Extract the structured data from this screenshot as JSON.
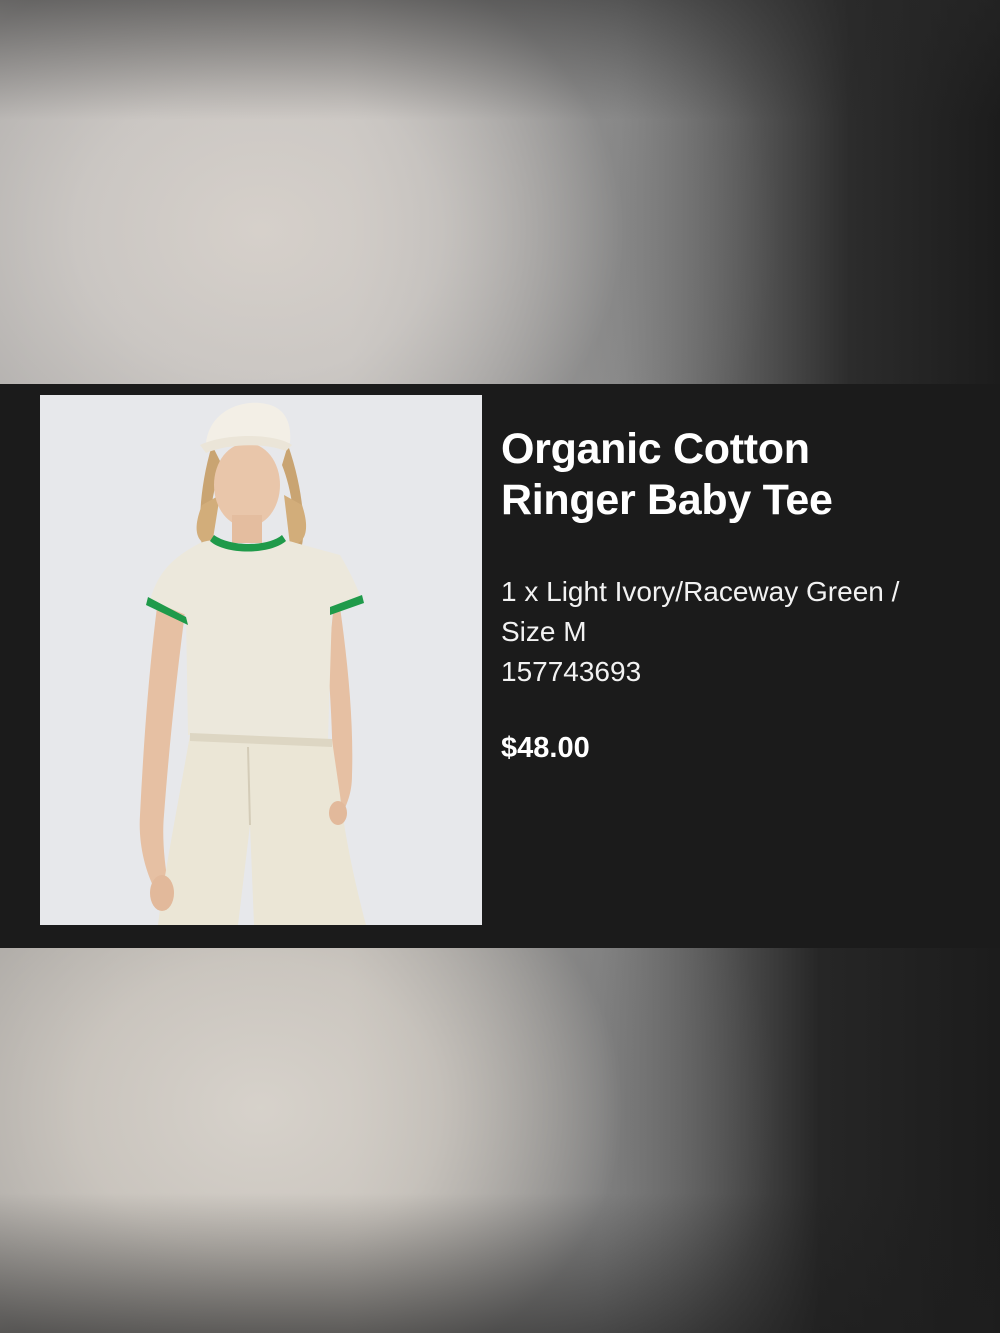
{
  "product": {
    "title_line1": "Organic Cotton",
    "title_line2": "Ringer Baby Tee",
    "variant_line1": "1 x Light Ivory/Raceway Green /",
    "variant_line2": "Size M",
    "sku": "157743693",
    "price": "$48.00",
    "image_alt": "Model wearing light ivory ringer tee with green trim, white cap and cream trousers"
  },
  "colors": {
    "card_background": "#1b1b1b",
    "text": "#ffffff",
    "shirt": "#ece8dc",
    "trim": "#1f9a4a"
  }
}
